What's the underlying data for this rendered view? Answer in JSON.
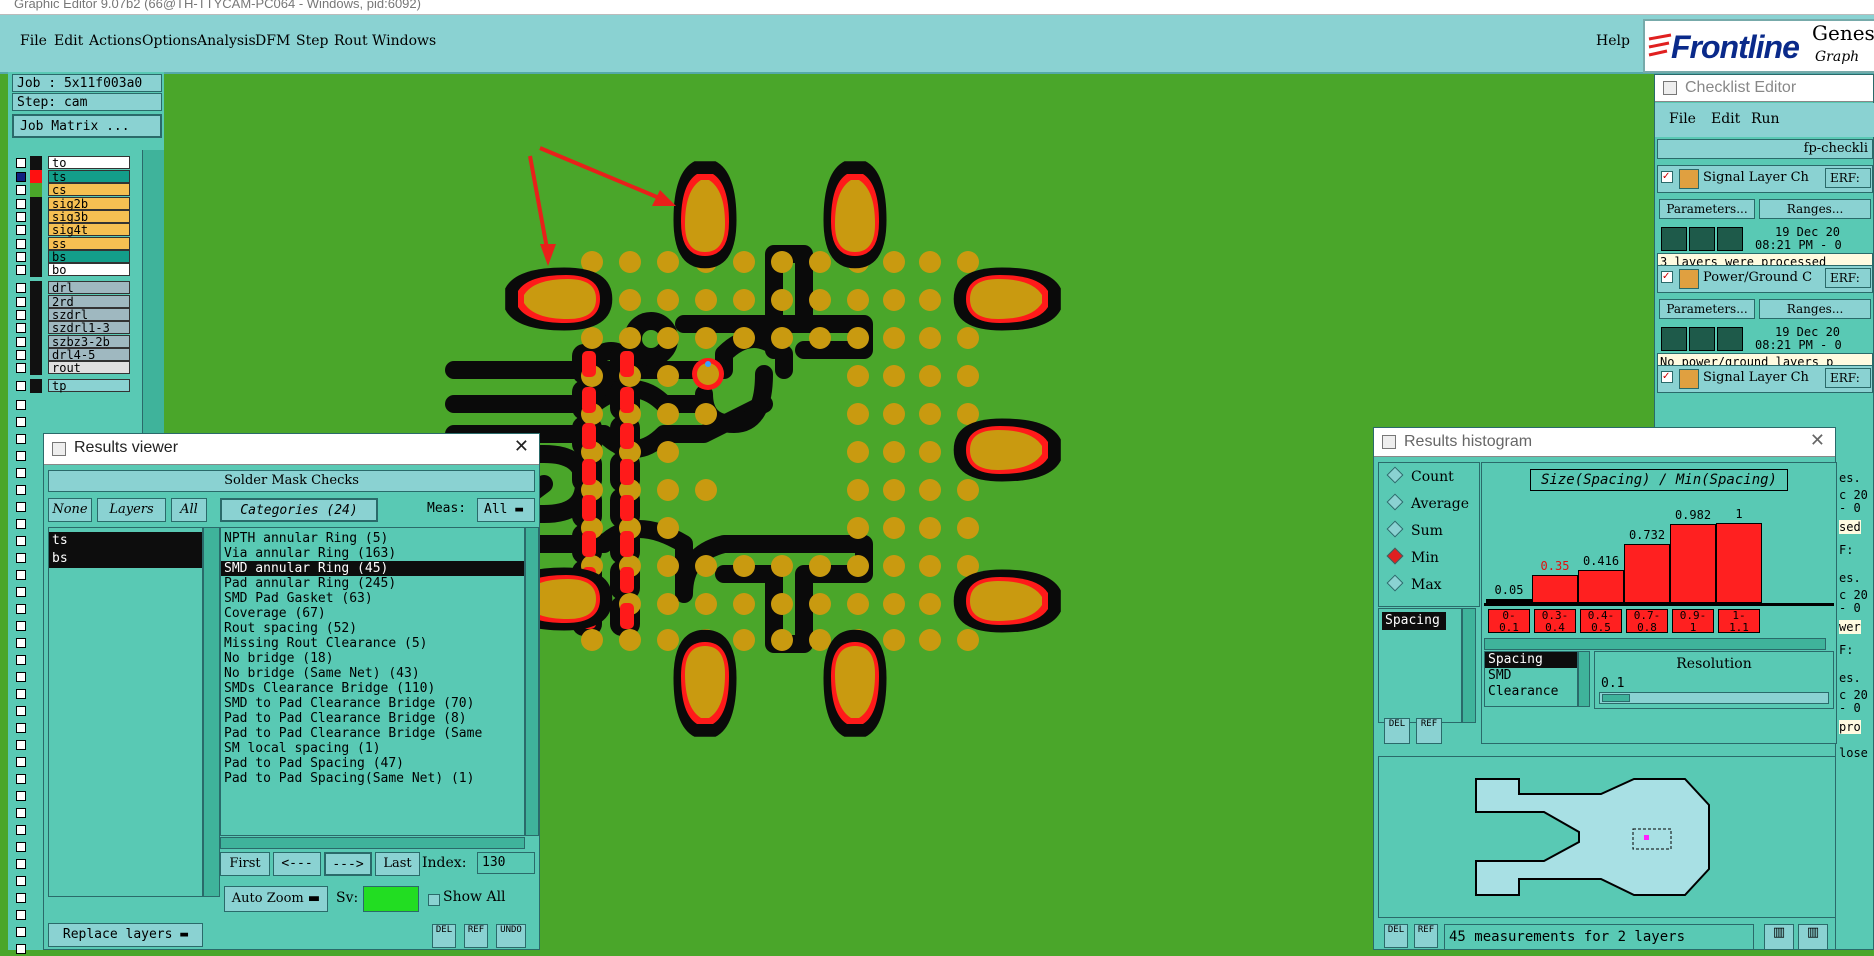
{
  "window_title": "Graphic Editor 9.07b2 (66@TH-TTYCAM-PC064 - Windows, pid:6092)",
  "menu": {
    "items": [
      "File",
      "Edit",
      "Actions",
      "Options",
      "Analysis",
      "DFM",
      "Step",
      "Rout",
      "Windows"
    ],
    "help": "Help"
  },
  "brand": {
    "name": "Frontline",
    "product": "Genes",
    "sub": "Graph"
  },
  "job": {
    "job_label": "Job : 5x11f003a0",
    "step_label": "Step: cam",
    "matrix_button": "Job Matrix ..."
  },
  "layers": [
    {
      "name": "to",
      "color": "#111111",
      "fill": "#ffffff"
    },
    {
      "name": "ts",
      "color": "#ff1010",
      "fill": "#139e8a"
    },
    {
      "name": "cs",
      "color": "#4aa62a",
      "fill": "#f6c052"
    },
    {
      "name": "sig2b",
      "color": "#111111",
      "fill": "#f6c052"
    },
    {
      "name": "sig3b",
      "color": "#111111",
      "fill": "#f6c052"
    },
    {
      "name": "sig4t",
      "color": "#111111",
      "fill": "#f6c052"
    },
    {
      "name": "ss",
      "color": "#111111",
      "fill": "#f6c052"
    },
    {
      "name": "bs",
      "color": "#111111",
      "fill": "#139e8a"
    },
    {
      "name": "bo",
      "color": "#111111",
      "fill": "#ffffff"
    },
    {
      "name": "drl",
      "color": "#111111",
      "fill": "#9fb8c0"
    },
    {
      "name": "2rd",
      "color": "#111111",
      "fill": "#9fb8c0"
    },
    {
      "name": "szdrl",
      "color": "#111111",
      "fill": "#9fb8c0"
    },
    {
      "name": "szdrl1-3",
      "color": "#111111",
      "fill": "#9fb8c0"
    },
    {
      "name": "szbz3-2b",
      "color": "#111111",
      "fill": "#9fb8c0"
    },
    {
      "name": "drl4-5",
      "color": "#111111",
      "fill": "#9fb8c0"
    },
    {
      "name": "rout",
      "color": "#111111",
      "fill": "#e0e0e0"
    },
    {
      "name": "tp",
      "color": "#111111",
      "fill": "#8ad2d2"
    }
  ],
  "results_viewer": {
    "title": "Results viewer",
    "header": "Solder Mask Checks",
    "none_btn": "None",
    "layers_btn": "Layers",
    "all_btn": "All",
    "categories_btn": "Categories (24)",
    "meas_label": "Meas:",
    "meas_value": "All",
    "selected_layers": [
      "ts",
      "bs"
    ],
    "categories": [
      "NPTH annular Ring (5)",
      "Via annular Ring (163)",
      "SMD annular Ring (45)",
      "Pad annular Ring (245)",
      "SMD Pad Gasket (63)",
      "Coverage (67)",
      "Rout spacing (52)",
      "Missing Rout Clearance (5)",
      "No bridge (18)",
      "No bridge (Same Net) (43)",
      "SMDs Clearance Bridge (110)",
      "SMD to Pad Clearance Bridge (70)",
      "Pad to Pad Clearance Bridge (8)",
      "Pad to Pad Clearance Bridge (Same",
      "SM local spacing (1)",
      "Pad to Pad Spacing (47)",
      "Pad to Pad Spacing(Same Net) (1)"
    ],
    "selected_category_index": 2,
    "first_btn": "First",
    "prev_btn": "<---",
    "next_btn": "--->",
    "last_btn": "Last",
    "index_label": "Index:",
    "index_value": "130",
    "autozoom_btn": "Auto Zoom",
    "sv_label": "Sv:",
    "show_all": "Show All",
    "replace_btn": "Replace layers",
    "del_btn": "DEL",
    "ref_btn": "REF",
    "undo_btn": "UNDO"
  },
  "checklist": {
    "title": "Checklist Editor",
    "menu": [
      "File",
      "Edit",
      "Run"
    ],
    "checklist_name": "fp-checkli",
    "entries": [
      {
        "name": "Signal Layer Ch",
        "erf": "ERF:",
        "params": "Parameters...",
        "ranges": "Ranges...",
        "date": "19 Dec 20",
        "time": "08:21 PM - 0",
        "msg": "3 layers were processed"
      },
      {
        "name": "Power/Ground C",
        "erf": "ERF:",
        "params": "Parameters...",
        "ranges": "Ranges...",
        "date": "19 Dec 20",
        "time": "08:21 PM - 0",
        "msg": "No power/ground layers p"
      },
      {
        "name": "Signal Layer Ch",
        "erf": "ERF:"
      }
    ],
    "side_fragments": [
      "es.",
      "c 20",
      "- 0",
      "sed",
      "F:",
      "es.",
      "c 20",
      "- 0",
      "wer",
      "F:",
      "es.",
      "c 20",
      "- 0",
      "pro",
      "lose"
    ]
  },
  "histogram": {
    "title": "Results histogram",
    "chart_title": "Size(Spacing) / Min(Spacing)",
    "modes": [
      "Count",
      "Average",
      "Sum",
      "Min",
      "Max"
    ],
    "selected_mode": "Min",
    "measure_list": [
      "Spacing"
    ],
    "bins": [
      {
        "range": "0-0.1",
        "top": "0-",
        "bot": "0.1",
        "value": "0.05",
        "v": 0.05
      },
      {
        "range": "0.3-0.4",
        "top": "0.3-",
        "bot": "0.4",
        "value": "0.35",
        "v": 0.35
      },
      {
        "range": "0.4-0.5",
        "top": "0.4-",
        "bot": "0.5",
        "value": "0.416",
        "v": 0.416
      },
      {
        "range": "0.7-0.8",
        "top": "0.7-",
        "bot": "0.8",
        "value": "0.732",
        "v": 0.732
      },
      {
        "range": "0.9-1",
        "top": "0.9-",
        "bot": "1",
        "value": "0.982",
        "v": 0.982
      },
      {
        "range": "1-1.1",
        "top": "1-",
        "bot": "1.1",
        "value": "1",
        "v": 1.0
      }
    ],
    "types": [
      "Spacing",
      "SMD",
      "Clearance"
    ],
    "resolution_label": "Resolution",
    "resolution_value": "0.1",
    "status": "45 measurements for 2 layers",
    "del_btn": "DEL",
    "ref_btn": "REF"
  },
  "colors": {
    "board": "#4aa62a",
    "pad": "#c99a10",
    "mask": "#0a0a0a",
    "violation": "#ff1a1a",
    "panel": "#59c9b4",
    "button": "#8ad2d2",
    "arrow": "#e8201a"
  }
}
